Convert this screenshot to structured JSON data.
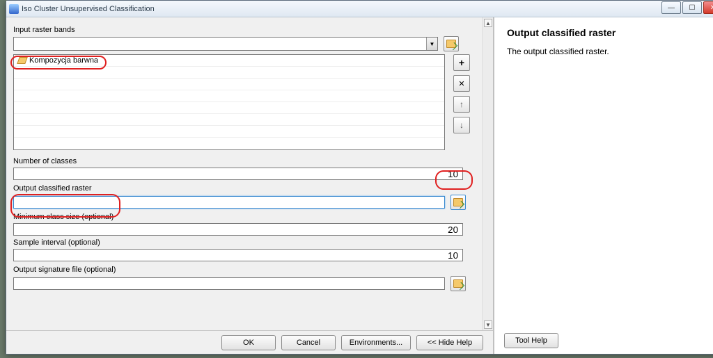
{
  "window": {
    "title": "Iso Cluster Unsupervised Classification"
  },
  "form": {
    "input_raster_label": "Input raster bands",
    "input_raster_value": "",
    "layer_item": "Kompozycja barwna",
    "num_classes_label": "Number of classes",
    "num_classes_value": "10",
    "out_raster_label": "Output classified raster",
    "out_raster_value": "",
    "min_class_label": "Minimum class size (optional)",
    "min_class_value": "20",
    "sample_label": "Sample interval (optional)",
    "sample_value": "10",
    "sig_label": "Output signature file (optional)",
    "sig_value": ""
  },
  "buttons": {
    "ok": "OK",
    "cancel": "Cancel",
    "env": "Environments...",
    "hide": "<< Hide Help",
    "tool": "Tool Help"
  },
  "help": {
    "title": "Output classified raster",
    "body": "The output classified raster."
  },
  "icons": {
    "dropdown": "▼",
    "up": "▲",
    "down": "▼",
    "uparrow": "↑",
    "downarrow": "↓",
    "plus": "+",
    "x": "✕",
    "min": "—",
    "max": "☐",
    "close": "✕"
  }
}
